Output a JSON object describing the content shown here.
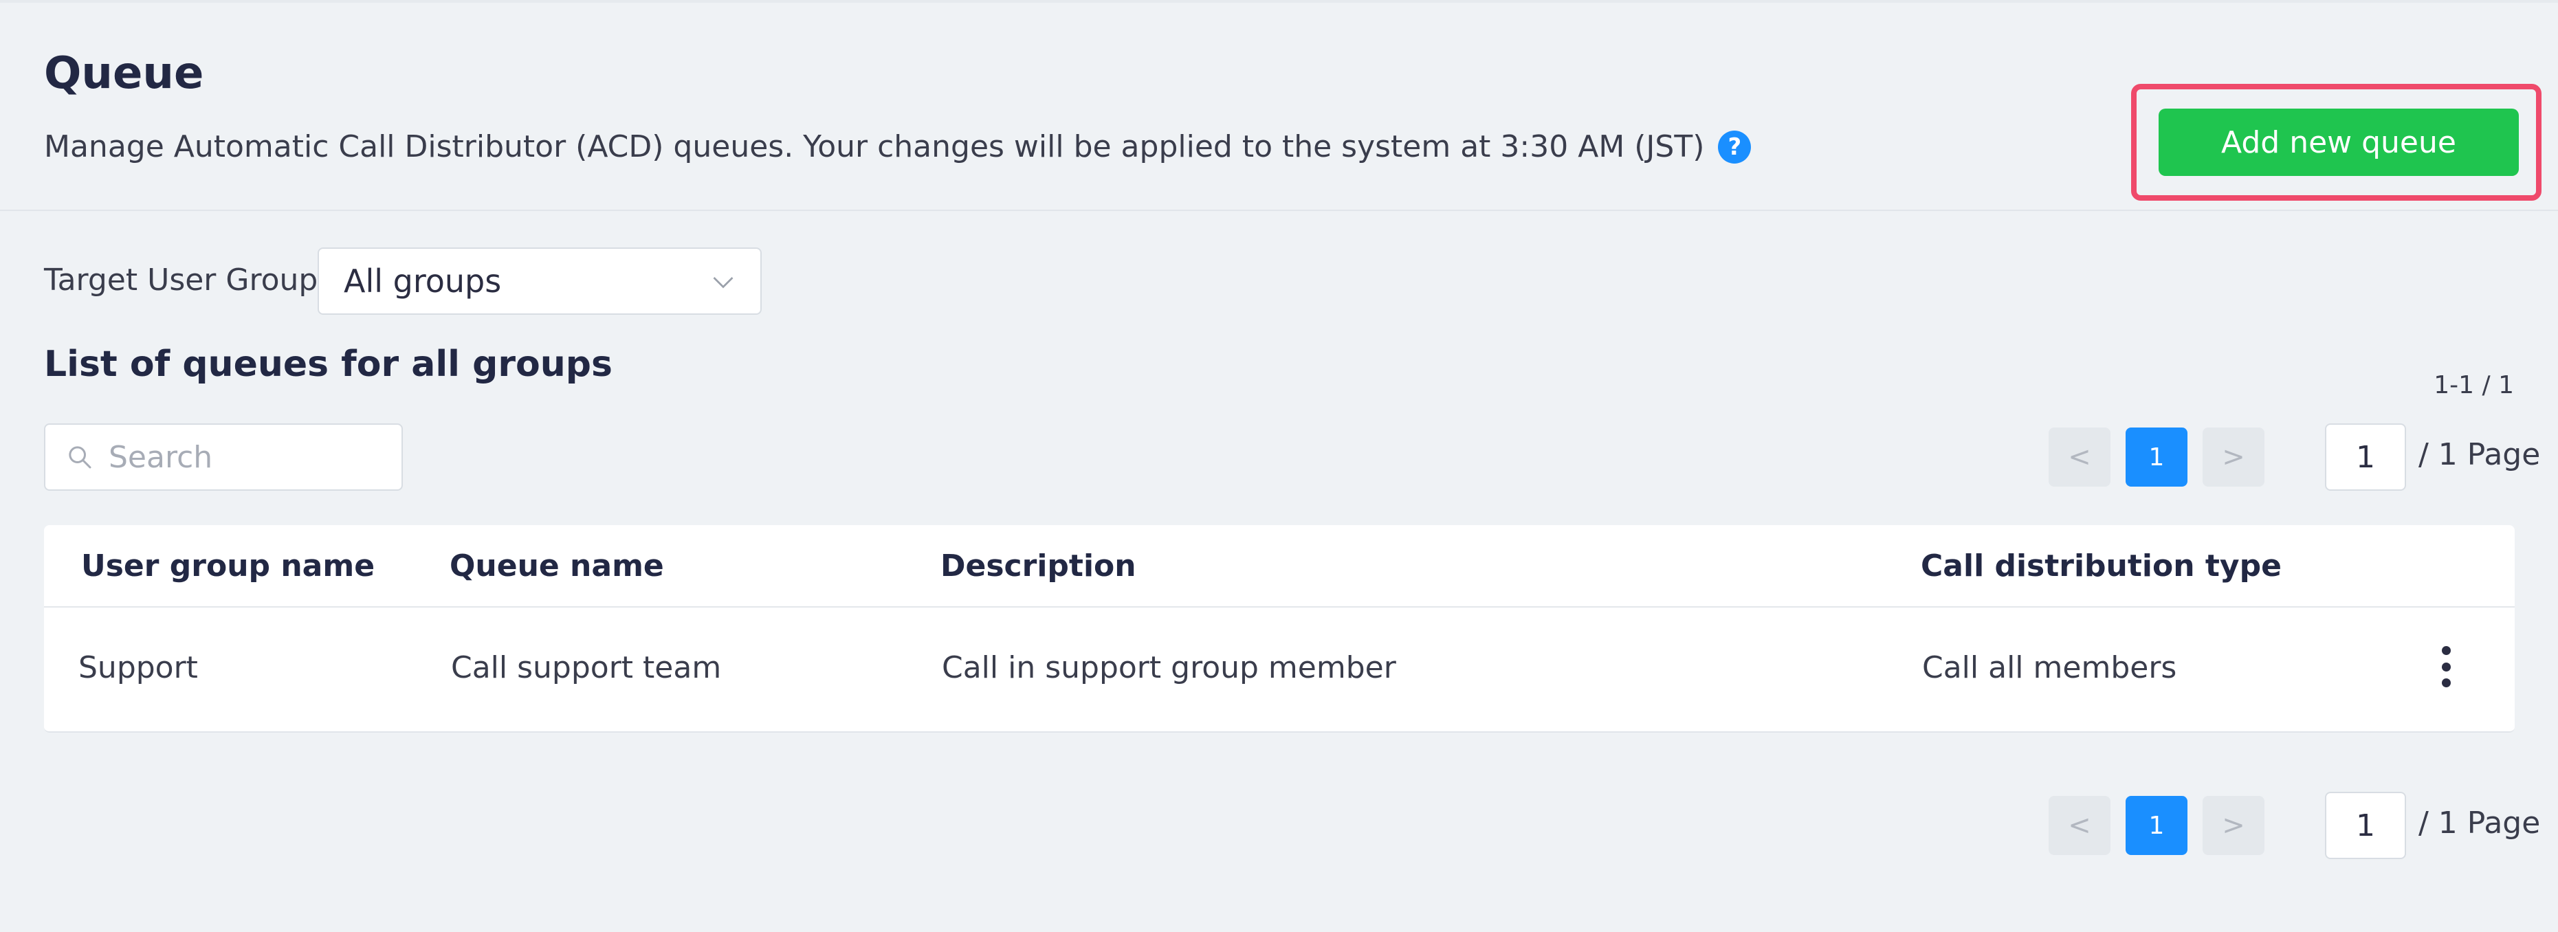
{
  "header": {
    "title": "Queue",
    "subtitle": "Manage Automatic Call Distributor (ACD) queues. Your changes will be applied to the system at 3:30 AM (JST)",
    "help_icon": "?",
    "add_button_label": "Add new queue",
    "highlight_color": "#ef4a6b",
    "add_button_color": "#1fc54f"
  },
  "filter": {
    "label": "Target User Group",
    "selected": "All groups",
    "icon": "chevron-down-icon"
  },
  "list": {
    "title": "List of queues for all groups",
    "count": "1-1 / 1",
    "search_placeholder": "Search",
    "search_icon": "search-icon"
  },
  "pagination": {
    "prev": "<",
    "next": ">",
    "current": "1",
    "page_input": "1",
    "total_label": "/ 1 Page",
    "accent": "#1a8fff"
  },
  "table": {
    "columns": [
      "User group name",
      "Queue name",
      "Description",
      "Call distribution type"
    ],
    "rows": [
      {
        "user_group": "Support",
        "queue_name": "Call support team",
        "description": "Call in support group member",
        "distribution": "Call all members"
      }
    ]
  }
}
